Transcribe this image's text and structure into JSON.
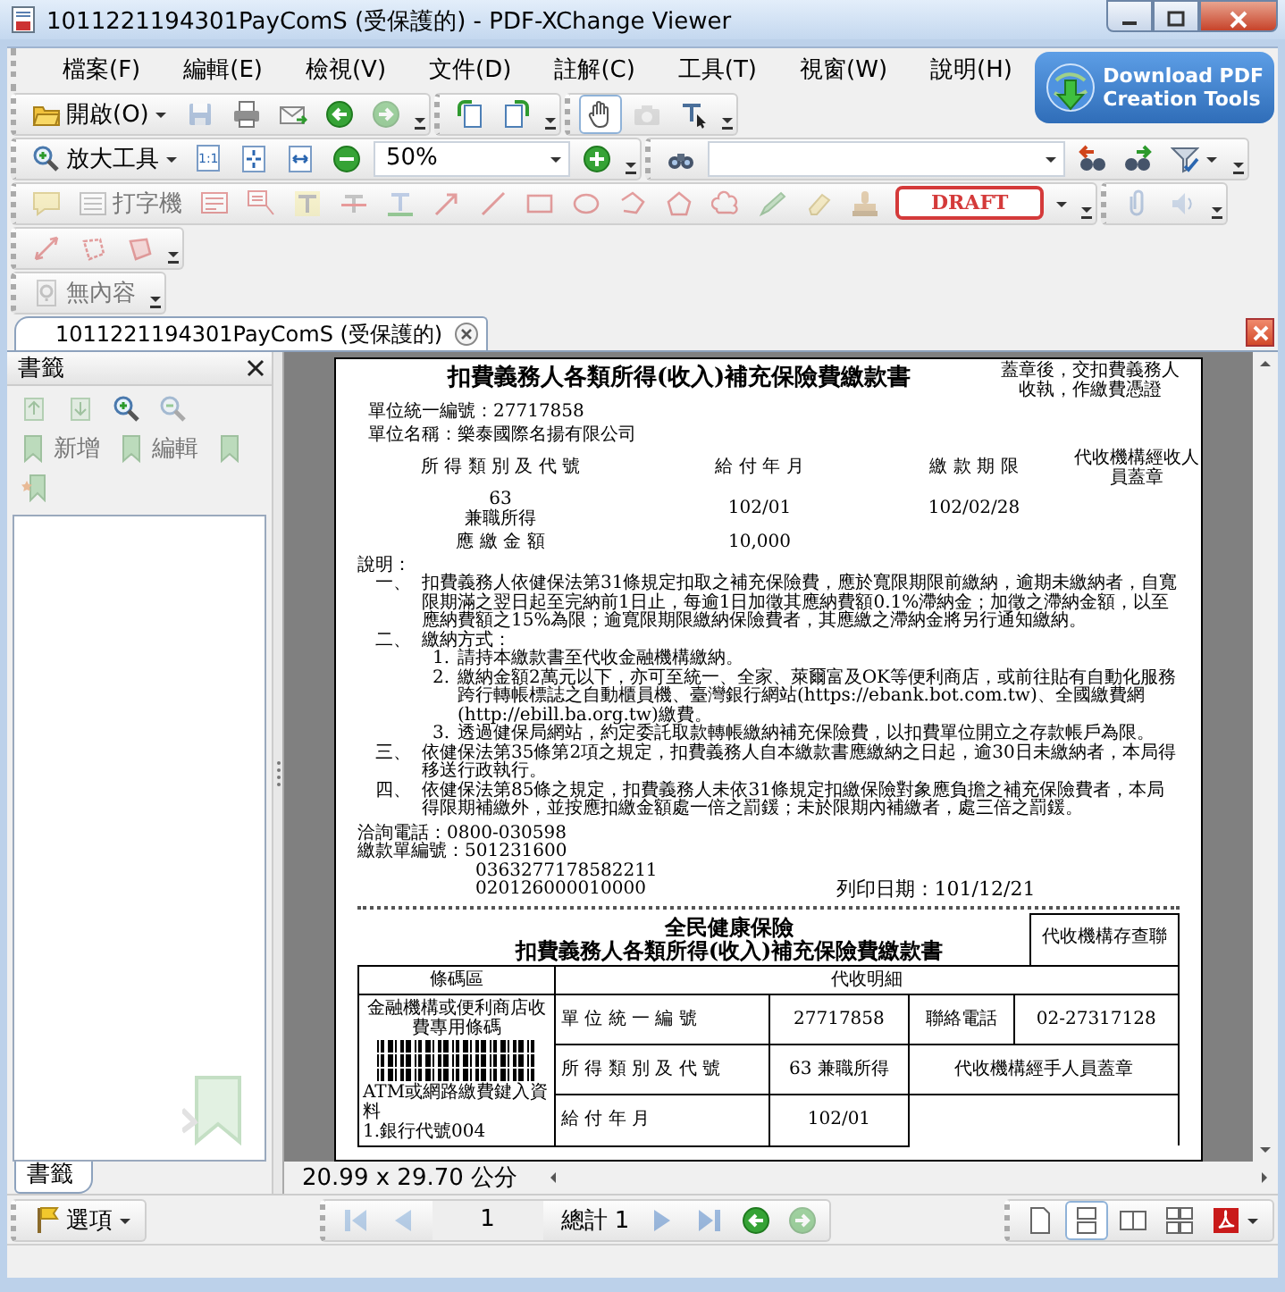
{
  "window": {
    "title": "1011221194301PayComS (受保護的) - PDF-XChange Viewer"
  },
  "menu": [
    {
      "label": "檔案(F)"
    },
    {
      "label": "編輯(E)"
    },
    {
      "label": "檢視(V)"
    },
    {
      "label": "文件(D)"
    },
    {
      "label": "註解(C)"
    },
    {
      "label": "工具(T)"
    },
    {
      "label": "視窗(W)"
    },
    {
      "label": "說明(H)"
    }
  ],
  "banner": {
    "line_1": "Download PDF",
    "line_2": "Creation Tools"
  },
  "toolbars": [
    [
      {
        "items": [
          {
            "kind": "open",
            "label": "開啟(O)",
            "dropdown": true
          },
          {
            "kind": "save",
            "disabled": true
          },
          {
            "kind": "print",
            "disabled": false
          },
          {
            "kind": "email",
            "disabled": false
          },
          {
            "kind": "back",
            "disabled": false
          },
          {
            "kind": "forward",
            "disabled": true
          }
        ]
      },
      {
        "items": [
          {
            "kind": "rotate-left"
          },
          {
            "kind": "rotate-right"
          }
        ]
      },
      {
        "items": [
          {
            "kind": "hand",
            "selected": true
          },
          {
            "kind": "snapshot",
            "selected": false,
            "disabled": true
          },
          {
            "kind": "select-text",
            "selected": false
          }
        ]
      }
    ],
    [
      {
        "items": [
          {
            "kind": "zoom",
            "label": "放大工具",
            "dropdown": true
          },
          {
            "kind": "actual-size",
            "label": "1:1"
          },
          {
            "kind": "fit-page"
          },
          {
            "kind": "fit-width"
          },
          {
            "kind": "zoom-out"
          },
          {
            "kind": "zoom-field",
            "value": "50%"
          },
          {
            "kind": "zoom-in"
          }
        ]
      },
      {
        "items": [
          {
            "kind": "binoculars"
          },
          {
            "kind": "search-field"
          },
          {
            "kind": "find-prev"
          },
          {
            "kind": "find-next"
          },
          {
            "kind": "filter",
            "dropdown": true
          }
        ]
      }
    ],
    [
      {
        "items": [
          {
            "kind": "note",
            "disabled": true
          },
          {
            "kind": "typewriter",
            "label": "打字機",
            "disabled": true
          },
          {
            "kind": "textbox",
            "disabled": true
          },
          {
            "kind": "callout",
            "disabled": true
          },
          {
            "kind": "highlight",
            "disabled": true
          },
          {
            "kind": "strikeout",
            "disabled": true
          },
          {
            "kind": "underline",
            "disabled": true
          },
          {
            "kind": "arrow",
            "disabled": true
          },
          {
            "kind": "line",
            "disabled": true
          },
          {
            "kind": "rect",
            "disabled": true
          },
          {
            "kind": "ellipse",
            "disabled": true
          },
          {
            "kind": "polyline",
            "disabled": true
          },
          {
            "kind": "polygon",
            "disabled": true
          },
          {
            "kind": "cloud",
            "disabled": true
          },
          {
            "kind": "pencil",
            "disabled": true
          },
          {
            "kind": "eraser",
            "disabled": true
          },
          {
            "kind": "stamp",
            "disabled": true
          },
          {
            "kind": "draft",
            "label": "DRAFT",
            "dropdown": true
          }
        ]
      },
      {
        "items": [
          {
            "kind": "attach",
            "disabled": true
          },
          {
            "kind": "sound",
            "disabled": true
          }
        ]
      }
    ],
    [
      {
        "items": [
          {
            "kind": "distance",
            "disabled": true
          },
          {
            "kind": "perimeter",
            "disabled": true
          },
          {
            "kind": "area",
            "disabled": true
          }
        ]
      }
    ],
    [
      {
        "items": [
          {
            "kind": "no-content",
            "label": "無內容",
            "disabled": true
          }
        ]
      }
    ]
  ],
  "document_tab": {
    "title": "1011221194301PayComS (受保護的)",
    "selected": true
  },
  "sidebar": {
    "title": "書籤",
    "tools": [
      {
        "kind": "bookmark-up",
        "disabled": true
      },
      {
        "kind": "bookmark-down",
        "disabled": true
      },
      {
        "kind": "expand",
        "disabled": false
      },
      {
        "kind": "collapse",
        "disabled": true
      },
      {
        "kind": "add-bookmark",
        "label": "新增",
        "disabled": true
      },
      {
        "kind": "edit-bookmark",
        "label": "編輯",
        "disabled": true
      },
      {
        "kind": "bookmark-options",
        "disabled": true
      },
      {
        "kind": "bookmark-properties",
        "disabled": true
      }
    ],
    "tab": {
      "label": "書籤",
      "selected": true
    }
  },
  "page": {
    "title": "扣費義務人各類所得(收入)補充保險費繳款書",
    "note": "蓋章後，交扣費義務人收執，作繳費憑證",
    "unit_id": "單位統一編號：27717858",
    "unit_name": "單位名稱：樂泰國際名揚有限公司",
    "columns": [
      "所 得 類 別 及 代 號",
      "給 付 年 月",
      "繳 款 期 限",
      "代收機構經收人員蓋章"
    ],
    "income_code": "63",
    "income_type": "兼職所得",
    "pay_month": "102/01",
    "deadline": "102/02/28",
    "amount_label": "應 繳 金 額",
    "amount": "10,000",
    "notes_title": "說明：",
    "notes": [
      {
        "mark": "一、",
        "text": "扣費義務人依健保法第31條規定扣取之補充保險費，應於寬限期限前繳納，逾期未繳納者，自寬限期滿之翌日起至完納前1日止，每逾1日加徵其應納費額0.1%滯納金；加徵之滯納金額，以至應納費額之15%為限；逾寬限期限繳納保險費者，其應繳之滯納金將另行通知繳納。"
      },
      {
        "mark": "二、",
        "text": "繳納方式：",
        "children": [
          {
            "mark": "1.",
            "text": "請持本繳款書至代收金融機構繳納。"
          },
          {
            "mark": "2.",
            "text": "繳納金額2萬元以下，亦可至統一、全家、萊爾富及OK等便利商店，或前往貼有自動化服務跨行轉帳標誌之自動櫃員機、臺灣銀行網站(https://ebank.bot.com.tw)、全國繳費網(http://ebill.ba.org.tw)繳費。"
          },
          {
            "mark": "3.",
            "text": "透過健保局網站，約定委託取款轉帳繳納補充保險費，以扣費單位開立之存款帳戶為限。"
          }
        ]
      },
      {
        "mark": "三、",
        "text": "依健保法第35條第2項之規定，扣費義務人自本繳款書應繳納之日起，逾30日未繳納者，本局得移送行政執行。"
      },
      {
        "mark": "四、",
        "text": "依健保法第85條之規定，扣費義務人未依31條規定扣繳保險對象應負擔之補充保險費者，本局得限期補繳外，並按應扣繳金額處一倍之罰鍰；未於限期內補繳者，處三倍之罰鍰。"
      }
    ],
    "contact": [
      "洽詢電話：0800-030598",
      "繳款單編號：501231600",
      "0363277178582211",
      "020126000010000"
    ],
    "print_date": "列印日期：101/12/21",
    "stub": {
      "title_1": "全民健康保險",
      "title_2": "扣費義務人各類所得(收入)補充保險費繳款書",
      "box": "代收機構存查聯",
      "barcode_header": "條碼區",
      "detail_header": "代收明細",
      "barcode_caption": "金融機構或便利商店收費專用條碼",
      "atm_lines": [
        "ATM或網路繳費鍵入資料",
        "1.銀行代號004"
      ],
      "rows": [
        [
          "單 位 統 一 編 號",
          "27717858",
          "聯絡電話",
          "02-27317128"
        ],
        [
          "所 得 類 別 及 代 號",
          "63 兼職所得",
          {
            "text": "代收機構經手人員蓋章",
            "colspan": 2
          }
        ],
        [
          "給 付 年 月",
          "102/01"
        ]
      ]
    }
  },
  "page_size": "20.99 x 29.70 公分",
  "bottom_bar": {
    "options": "選項",
    "nav": [
      {
        "kind": "first",
        "disabled": true
      },
      {
        "kind": "prev",
        "disabled": true
      },
      {
        "kind": "page-field",
        "value": "1"
      },
      {
        "kind": "total",
        "label": "總計 1"
      },
      {
        "kind": "next",
        "disabled": true
      },
      {
        "kind": "last",
        "disabled": true
      },
      {
        "kind": "back",
        "disabled": false
      },
      {
        "kind": "forward",
        "disabled": true
      }
    ],
    "views": [
      {
        "kind": "single",
        "selected": false
      },
      {
        "kind": "continuous",
        "selected": true
      },
      {
        "kind": "facing",
        "selected": false
      },
      {
        "kind": "facing-continuous",
        "selected": false
      }
    ]
  }
}
